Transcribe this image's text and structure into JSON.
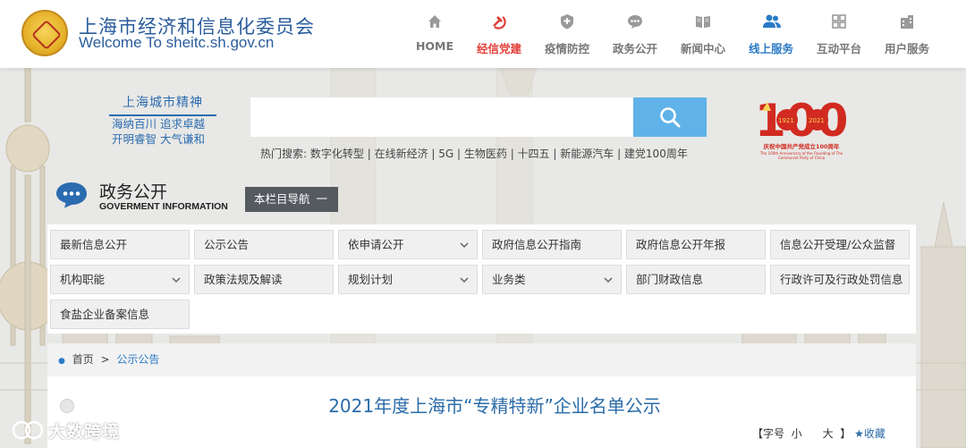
{
  "header": {
    "org_name_cn": "上海市经济和信息化委员会",
    "org_name_en": "Welcome  To  sheitc.sh.gov.cn",
    "nav": [
      {
        "label": "HOME",
        "icon": "home-icon"
      },
      {
        "label": "经信党建",
        "icon": "hammer-sickle-icon"
      },
      {
        "label": "疫情防控",
        "icon": "shield-icon"
      },
      {
        "label": "政务公开",
        "icon": "chat-bubble-icon"
      },
      {
        "label": "新闻中心",
        "icon": "book-icon"
      },
      {
        "label": "线上服务",
        "icon": "users-icon"
      },
      {
        "label": "互动平台",
        "icon": "grid-icon"
      },
      {
        "label": "用户服务",
        "icon": "building-icon"
      }
    ]
  },
  "slogan": {
    "title": "上海城市精神",
    "line1": "海纳百川  追求卓越",
    "line2": "开明睿智  大气谦和"
  },
  "search": {
    "placeholder": "",
    "hot_label": "热门搜索:",
    "hot_terms": [
      "数字化转型",
      "在线新经济",
      "5G",
      "生物医药",
      "十四五",
      "新能源汽车",
      "建党100周年"
    ]
  },
  "anniversary": {
    "number": "100",
    "year_left": "1921",
    "year_right": "2021",
    "caption_cn": "庆祝中国共产党成立100周年",
    "caption_en": "The 100th Anniversary of the Founding of The Communist Party of China"
  },
  "section": {
    "title": "政务公开",
    "subtitle": "GOVERMENT INFORMATION",
    "column_nav_label": "本栏目导航",
    "column_nav_toggle": "一"
  },
  "categories": [
    {
      "label": "最新信息公开",
      "dropdown": false
    },
    {
      "label": "公示公告",
      "dropdown": false
    },
    {
      "label": "依申请公开",
      "dropdown": true
    },
    {
      "label": "政府信息公开指南",
      "dropdown": false
    },
    {
      "label": "政府信息公开年报",
      "dropdown": false
    },
    {
      "label": "信息公开受理/公众监督",
      "dropdown": false
    },
    {
      "label": "机构职能",
      "dropdown": true
    },
    {
      "label": "政策法规及解读",
      "dropdown": false
    },
    {
      "label": "规划计划",
      "dropdown": true
    },
    {
      "label": "业务类",
      "dropdown": true
    },
    {
      "label": "部门财政信息",
      "dropdown": false
    },
    {
      "label": "行政许可及行政处罚信息",
      "dropdown": false
    },
    {
      "label": "食盐企业备案信息",
      "dropdown": false
    }
  ],
  "breadcrumb": {
    "home": "首页",
    "separator": ">",
    "current": "公示公告"
  },
  "article": {
    "title": "2021年度上海市“专精特新”企业名单公示",
    "font_label": "【字号",
    "font_small": "小",
    "font_large": "大",
    "font_close": "】",
    "favorite": "★收藏"
  },
  "watermark": {
    "text": "大数跨境"
  },
  "colors": {
    "brand_blue": "#2a5d9c",
    "party_red": "#e2403a",
    "search_button": "#5fb3e8",
    "nav_button_dark": "#555a60"
  }
}
